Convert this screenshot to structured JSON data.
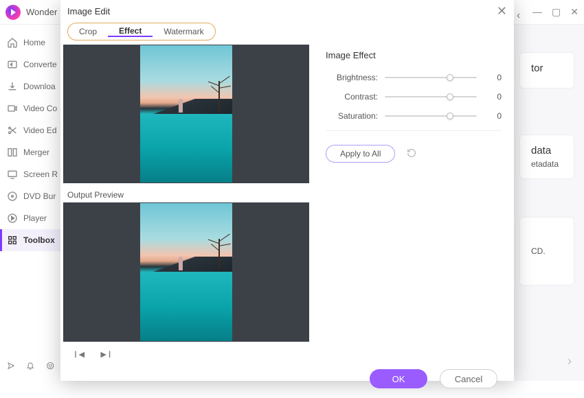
{
  "app": {
    "title": "Wonder"
  },
  "window_controls": {
    "min": "—",
    "max": "▢",
    "close": "✕"
  },
  "sidebar": {
    "items": [
      {
        "label": "Home"
      },
      {
        "label": "Converte"
      },
      {
        "label": "Downloa"
      },
      {
        "label": "Video Co"
      },
      {
        "label": "Video Ed"
      },
      {
        "label": "Merger"
      },
      {
        "label": "Screen R"
      },
      {
        "label": "DVD Bur"
      },
      {
        "label": "Player"
      },
      {
        "label": "Toolbox"
      }
    ]
  },
  "bg_cards": {
    "top": {
      "title": "tor"
    },
    "mid": {
      "title": "data",
      "sub": "etadata"
    },
    "bot": {
      "text": "CD."
    }
  },
  "modal": {
    "title": "Image Edit",
    "tabs": {
      "crop": "Crop",
      "effect": "Effect",
      "watermark": "Watermark"
    },
    "output_label": "Output Preview",
    "section_title": "Image Effect",
    "sliders": {
      "brightness": {
        "label": "Brightness:",
        "value": "0"
      },
      "contrast": {
        "label": "Contrast:",
        "value": "0"
      },
      "saturation": {
        "label": "Saturation:",
        "value": "0"
      }
    },
    "apply_all": "Apply to All",
    "ok": "OK",
    "cancel": "Cancel"
  }
}
